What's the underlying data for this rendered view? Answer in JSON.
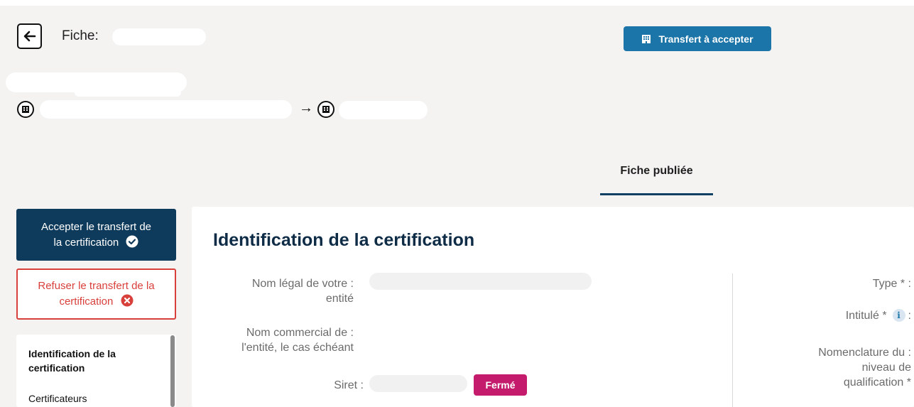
{
  "header": {
    "fiche_label": "Fiche:",
    "transfer_button": "Transfert à accepter",
    "arrow": "→"
  },
  "tabs": [
    {
      "label": "Fiche publiée",
      "active": true
    }
  ],
  "sidebar": {
    "accept_button": [
      "Accepter le transfert de",
      "la certification"
    ],
    "refuse_button": [
      "Refuser le transfert de la",
      "certification"
    ],
    "nav_items": [
      {
        "label": "Identification de la certification",
        "active": true
      },
      {
        "label": "Certificateurs",
        "active": false
      }
    ]
  },
  "main": {
    "section_title": "Identification de la certification",
    "left_fields": [
      {
        "label_line1": "Nom légal de votre :",
        "label_line2": "entité"
      },
      {
        "label_line1": "Nom commercial de :",
        "label_line2": "l'entité, le cas échéant"
      },
      {
        "label_line1": "Siret :"
      }
    ],
    "siret_status": "Fermé",
    "right_fields": [
      {
        "label": "Type * :"
      },
      {
        "label": "Intitulé *",
        "suffix": ":",
        "info_icon": "i"
      },
      {
        "label_line1": "Nomenclature du :",
        "label_line2": "niveau de",
        "label_line3": "qualification *"
      }
    ]
  },
  "colors": {
    "accent_blue": "#1b75a8",
    "navy": "#0e3a5b",
    "danger_red": "#d8403c",
    "badge_pink": "#c51b6d",
    "background": "#f4f3f2"
  },
  "icons": [
    "back-arrow-icon",
    "building-icon",
    "check-circle-icon",
    "x-circle-icon",
    "info-icon"
  ]
}
